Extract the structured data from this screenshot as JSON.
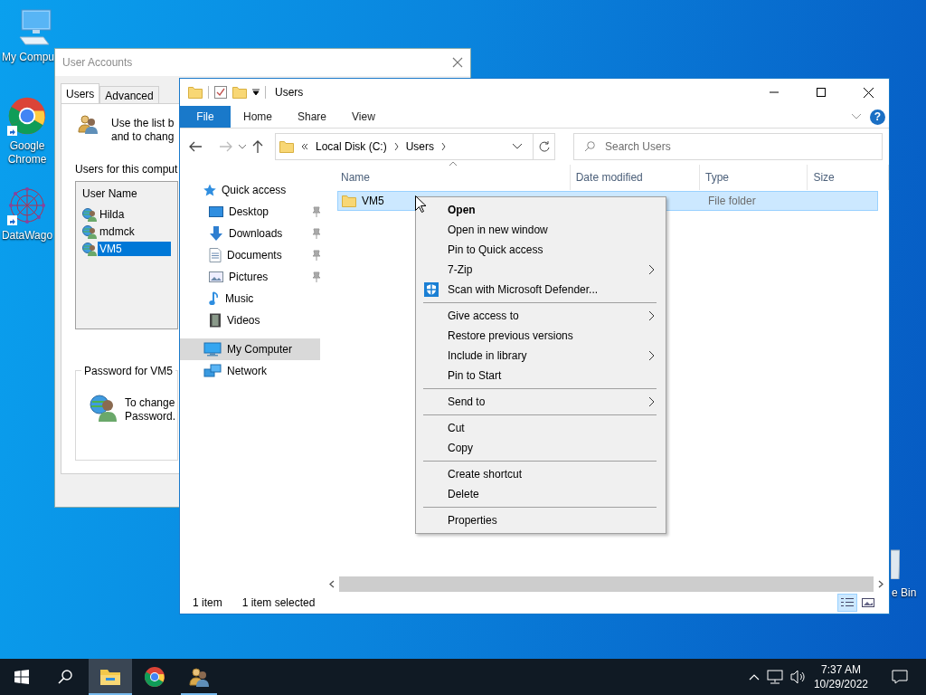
{
  "desktop": {
    "icons": [
      {
        "kind": "computer",
        "label": "My Compu"
      },
      {
        "kind": "browser",
        "label": "Google Chrome"
      },
      {
        "kind": "app",
        "label": "DataWago"
      }
    ],
    "recycle_bin": {
      "label": "e Bin"
    }
  },
  "user_accounts": {
    "title": "User Accounts",
    "tabs": [
      {
        "label": "Users",
        "selected": true
      },
      {
        "label": "Advanced",
        "selected": false
      }
    ],
    "intro": [
      "Use the list b",
      "and to chang"
    ],
    "users_label": "Users for this comput",
    "list_header": "User Name",
    "users": [
      {
        "name": "Hilda",
        "selected": false
      },
      {
        "name": "mdmck",
        "selected": false
      },
      {
        "name": "VM5",
        "selected": true
      }
    ],
    "password_group": {
      "title": "Password for VM5",
      "text": [
        "To change",
        "Password."
      ]
    }
  },
  "explorer": {
    "title": "Users",
    "ribbon_tabs": [
      {
        "label": "File",
        "selected": true
      },
      {
        "label": "Home",
        "selected": false
      },
      {
        "label": "Share",
        "selected": false
      },
      {
        "label": "View",
        "selected": false
      }
    ],
    "help": "?",
    "breadcrumb": [
      "Local Disk (C:)",
      "Users"
    ],
    "search": {
      "placeholder": "Search Users"
    },
    "nav": [
      {
        "kind": "quick",
        "label": "Quick access",
        "selected": false,
        "children": [
          {
            "kind": "desktop",
            "label": "Desktop",
            "pinned": true,
            "selected": false
          },
          {
            "kind": "downloads",
            "label": "Downloads",
            "pinned": true,
            "selected": false
          },
          {
            "kind": "documents",
            "label": "Documents",
            "pinned": true,
            "selected": false
          },
          {
            "kind": "pictures",
            "label": "Pictures",
            "pinned": true,
            "selected": false
          },
          {
            "kind": "music",
            "label": "Music",
            "pinned": false,
            "selected": false
          },
          {
            "kind": "videos",
            "label": "Videos",
            "pinned": false,
            "selected": false
          }
        ]
      },
      {
        "kind": "computer",
        "label": "My Computer",
        "selected": true
      },
      {
        "kind": "network",
        "label": "Network",
        "selected": false
      }
    ],
    "columns": [
      "Name",
      "Date modified",
      "Type",
      "Size"
    ],
    "rows": [
      {
        "name": "VM5",
        "type": "File folder",
        "selected": true
      }
    ],
    "status": {
      "count": "1 item",
      "selection": "1 item selected"
    },
    "views": [
      {
        "kind": "details",
        "selected": true
      },
      {
        "kind": "large-icons",
        "selected": false
      }
    ]
  },
  "context_menu": {
    "groups": [
      [
        {
          "kind": "plain",
          "label": "Open",
          "default": true,
          "submenu": false
        },
        {
          "kind": "plain",
          "label": "Open in new window",
          "default": false,
          "submenu": false
        },
        {
          "kind": "plain",
          "label": "Pin to Quick access",
          "default": false,
          "submenu": false
        },
        {
          "kind": "plain",
          "label": "7-Zip",
          "default": false,
          "submenu": true
        },
        {
          "kind": "shield",
          "label": "Scan with Microsoft Defender...",
          "default": false,
          "submenu": false
        }
      ],
      [
        {
          "kind": "plain",
          "label": "Give access to",
          "default": false,
          "submenu": true
        },
        {
          "kind": "plain",
          "label": "Restore previous versions",
          "default": false,
          "submenu": false
        },
        {
          "kind": "plain",
          "label": "Include in library",
          "default": false,
          "submenu": true
        },
        {
          "kind": "plain",
          "label": "Pin to Start",
          "default": false,
          "submenu": false
        }
      ],
      [
        {
          "kind": "plain",
          "label": "Send to",
          "default": false,
          "submenu": true
        }
      ],
      [
        {
          "kind": "plain",
          "label": "Cut",
          "default": false,
          "submenu": false
        },
        {
          "kind": "plain",
          "label": "Copy",
          "default": false,
          "submenu": false
        }
      ],
      [
        {
          "kind": "plain",
          "label": "Create shortcut",
          "default": false,
          "submenu": false
        },
        {
          "kind": "plain",
          "label": "Delete",
          "default": false,
          "submenu": false
        }
      ],
      [
        {
          "kind": "plain",
          "label": "Properties",
          "default": false,
          "submenu": false
        }
      ]
    ]
  },
  "taskbar": {
    "apps": [
      {
        "kind": "explorer",
        "active": true,
        "running": true
      },
      {
        "kind": "browser",
        "active": false,
        "running": false
      },
      {
        "kind": "users",
        "active": false,
        "running": true
      }
    ],
    "time": "7:37 AM",
    "date": "10/29/2022"
  }
}
